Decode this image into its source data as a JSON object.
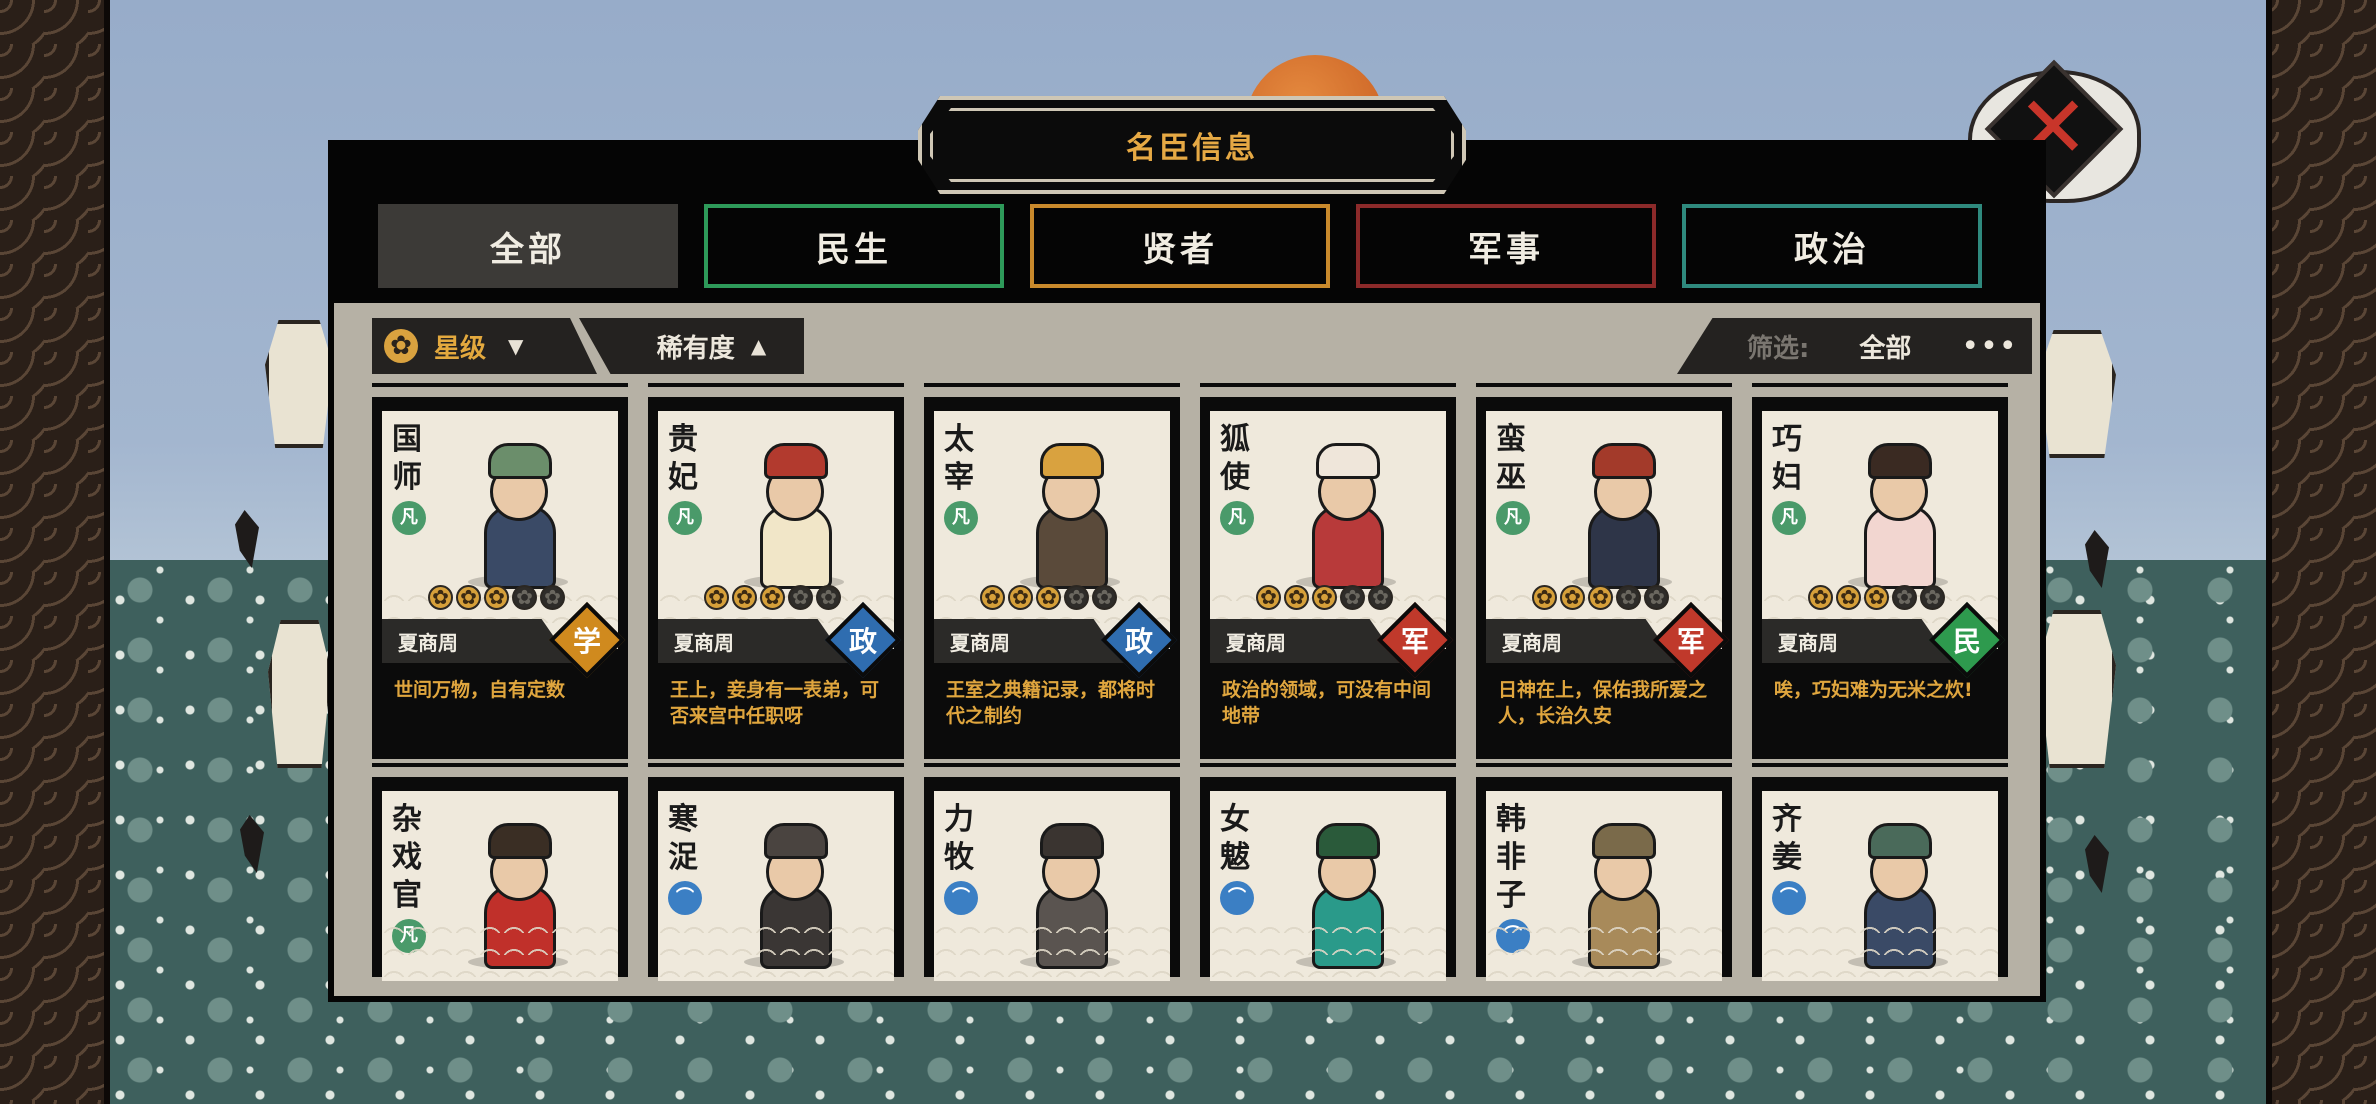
{
  "panel": {
    "title": "名臣信息",
    "tabs": [
      {
        "label": "全部",
        "style": "active"
      },
      {
        "label": "民生",
        "style": "green"
      },
      {
        "label": "贤者",
        "style": "gold"
      },
      {
        "label": "军事",
        "style": "red"
      },
      {
        "label": "政治",
        "style": "teal"
      }
    ],
    "sort_star": {
      "icon": "flower-icon",
      "label": "星级",
      "arrow": "▼"
    },
    "sort_rarity": {
      "label": "稀有度",
      "arrow": "▲"
    },
    "filter": {
      "label": "筛选:",
      "value": "全部",
      "more": "•••"
    }
  },
  "colors": {
    "xue": "#d08a1e",
    "zheng": "#2f6db0",
    "jun": "#c0392b",
    "min": "#2e9a4e",
    "gold_text": "#e0a63e"
  },
  "cards": [
    {
      "name": "国师",
      "rarity": "凡",
      "stars": 3,
      "dynasty": "夏商周",
      "type": "学",
      "type_color": "#d08a1e",
      "quote": "世间万物，自有定数",
      "robe": "#3a4a66",
      "hat": "#6b8e6b"
    },
    {
      "name": "贵妃",
      "rarity": "凡",
      "stars": 3,
      "dynasty": "夏商周",
      "type": "政",
      "type_color": "#2f6db0",
      "quote": "王上，妾身有一表弟，可否来宫中任职呀",
      "robe": "#f1e6c8",
      "hat": "#b23a2e"
    },
    {
      "name": "太宰",
      "rarity": "凡",
      "stars": 3,
      "dynasty": "夏商周",
      "type": "政",
      "type_color": "#2f6db0",
      "quote": "王室之典籍记录，都将时代之制约",
      "robe": "#5a4a3a",
      "hat": "#d9a23f"
    },
    {
      "name": "狐使",
      "rarity": "凡",
      "stars": 3,
      "dynasty": "夏商周",
      "type": "军",
      "type_color": "#c0392b",
      "quote": "政治的领域，可没有中间地带",
      "robe": "#b83a3a",
      "hat": "#efe6da"
    },
    {
      "name": "蛮巫",
      "rarity": "凡",
      "stars": 3,
      "dynasty": "夏商周",
      "type": "军",
      "type_color": "#c0392b",
      "quote": "日神在上，保佑我所爱之人，长治久安",
      "robe": "#2e3548",
      "hat": "#a33a2a"
    },
    {
      "name": "巧妇",
      "rarity": "凡",
      "stars": 3,
      "dynasty": "夏商周",
      "type": "民",
      "type_color": "#2e9a4e",
      "quote": "唉，巧妇难为无米之炊!",
      "robe": "#f2d6d0",
      "hat": "#3a2a22"
    },
    {
      "name": "杂戏官",
      "rarity": "凡",
      "robe": "#c0302a",
      "hat": "#3a2e24"
    },
    {
      "name": "寒浞",
      "rarity": "⌒",
      "robe": "#3a3634",
      "hat": "#4a4440"
    },
    {
      "name": "力牧",
      "rarity": "⌒",
      "robe": "#5a5450",
      "hat": "#3a3430"
    },
    {
      "name": "女魃",
      "rarity": "⌒",
      "robe": "#2a9a8a",
      "hat": "#2a5a3a"
    },
    {
      "name": "韩非子",
      "rarity": "⌒",
      "robe": "#a88a5a",
      "hat": "#7a6a4a"
    },
    {
      "name": "齐姜",
      "rarity": "⌒",
      "robe": "#3a4a66",
      "hat": "#4a6a5a"
    }
  ]
}
